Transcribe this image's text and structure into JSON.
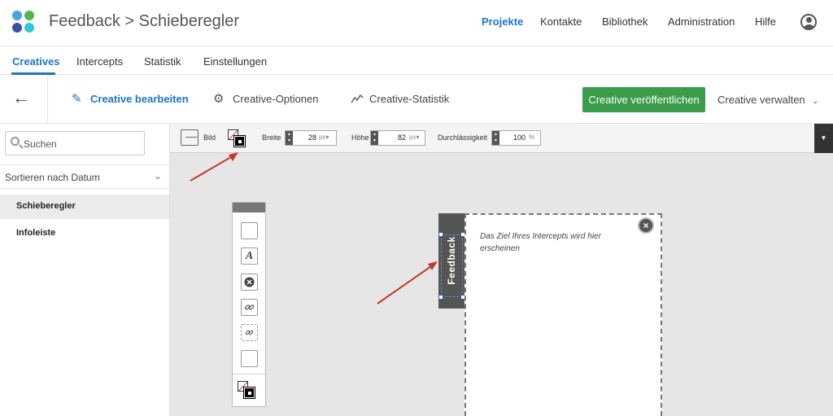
{
  "header": {
    "title": "Feedback > Schieberegler",
    "nav": [
      "Projekte",
      "Kontakte",
      "Bibliothek",
      "Administration",
      "Hilfe"
    ],
    "logo_colors": [
      "#4aa3df",
      "#52b548",
      "#3c4fa3",
      "#34c6d6"
    ]
  },
  "subnav": {
    "tabs": [
      "Creatives",
      "Intercepts",
      "Statistik",
      "Einstellungen"
    ]
  },
  "actionbar": {
    "edit": "Creative bearbeiten",
    "options": "Creative-Optionen",
    "stats": "Creative-Statistik",
    "publish": "Creative veröffentlichen",
    "manage": "Creative verwalten"
  },
  "sidebar": {
    "search_placeholder": "Suchen",
    "sort_label": "Sortieren nach Datum",
    "items": [
      "Schieberegler",
      "Infoleiste"
    ]
  },
  "toolbar": {
    "image_label": "Bild",
    "width_label": "Breite",
    "width_value": "28",
    "width_unit": "px",
    "height_label": "Höhe",
    "height_value": "82",
    "height_unit": "px",
    "opacity_label": "Durchlässigkeit",
    "opacity_value": "100",
    "opacity_unit": "%"
  },
  "preview": {
    "tab_label": "Feedback",
    "placeholder": "Das Ziel Ihres Intercepts wird hier erscheinen"
  },
  "colors": {
    "accent": "#1c76c7",
    "publish_green": "#3b9c4b",
    "arrow_red": "#c0392b"
  }
}
